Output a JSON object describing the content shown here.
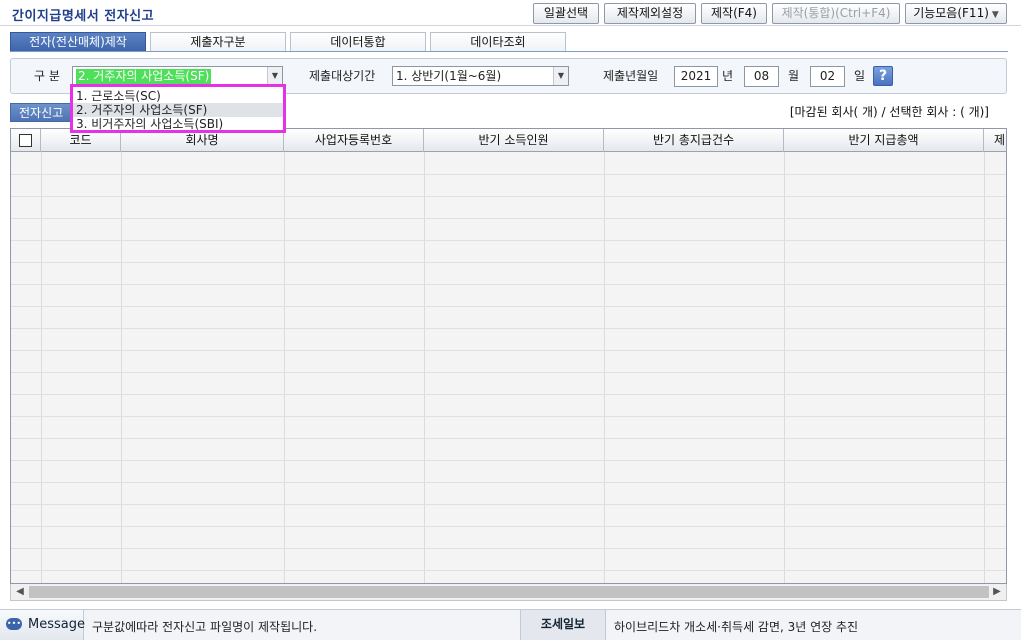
{
  "window": {
    "title": "간이지급명세서 전자신고"
  },
  "toolbar": {
    "batch_select": "일괄선택",
    "exclude_settings": "제작제외설정",
    "create": "제작(F4)",
    "create_merged": "제작(통합)(Ctrl+F4)",
    "functions": "기능모음(F11)"
  },
  "tabs": [
    {
      "label": "전자(전산매체)제작"
    },
    {
      "label": "제출자구분"
    },
    {
      "label": "데이터통합"
    },
    {
      "label": "데이타조회"
    }
  ],
  "filter": {
    "type_label": "구 분",
    "type_value": "2. 거주자의 사업소득(SF)",
    "period_label": "제출대상기간",
    "period_value": "1. 상반기(1월~6월)",
    "date_label": "제출년월일",
    "year": "2021",
    "year_unit": "년",
    "month": "08",
    "month_unit": "월",
    "day": "02",
    "day_unit": "일",
    "help": "?"
  },
  "dropdown_options": [
    "1. 근로소득(SC)",
    "2. 거주자의 사업소득(SF)",
    "3. 비거주자의 사업소득(SBI)"
  ],
  "subtab": {
    "label": "전자신고"
  },
  "count_text": "[마감된 회사(  개) / 선택한 회사 : (  개)]",
  "grid": {
    "columns": [
      "",
      "코드",
      "회사명",
      "사업자등록번호",
      "반기 소득인원",
      "반기 총지급건수",
      "반기 지급총액",
      "제"
    ]
  },
  "status": {
    "message_button": "Message",
    "message_text": "구분값에따라 전자신고 파일명이 제작됩니다.",
    "news_label": "조세일보",
    "news_text": "하이브리드차 개소세·취득세 감면, 3년 연장 추진"
  }
}
